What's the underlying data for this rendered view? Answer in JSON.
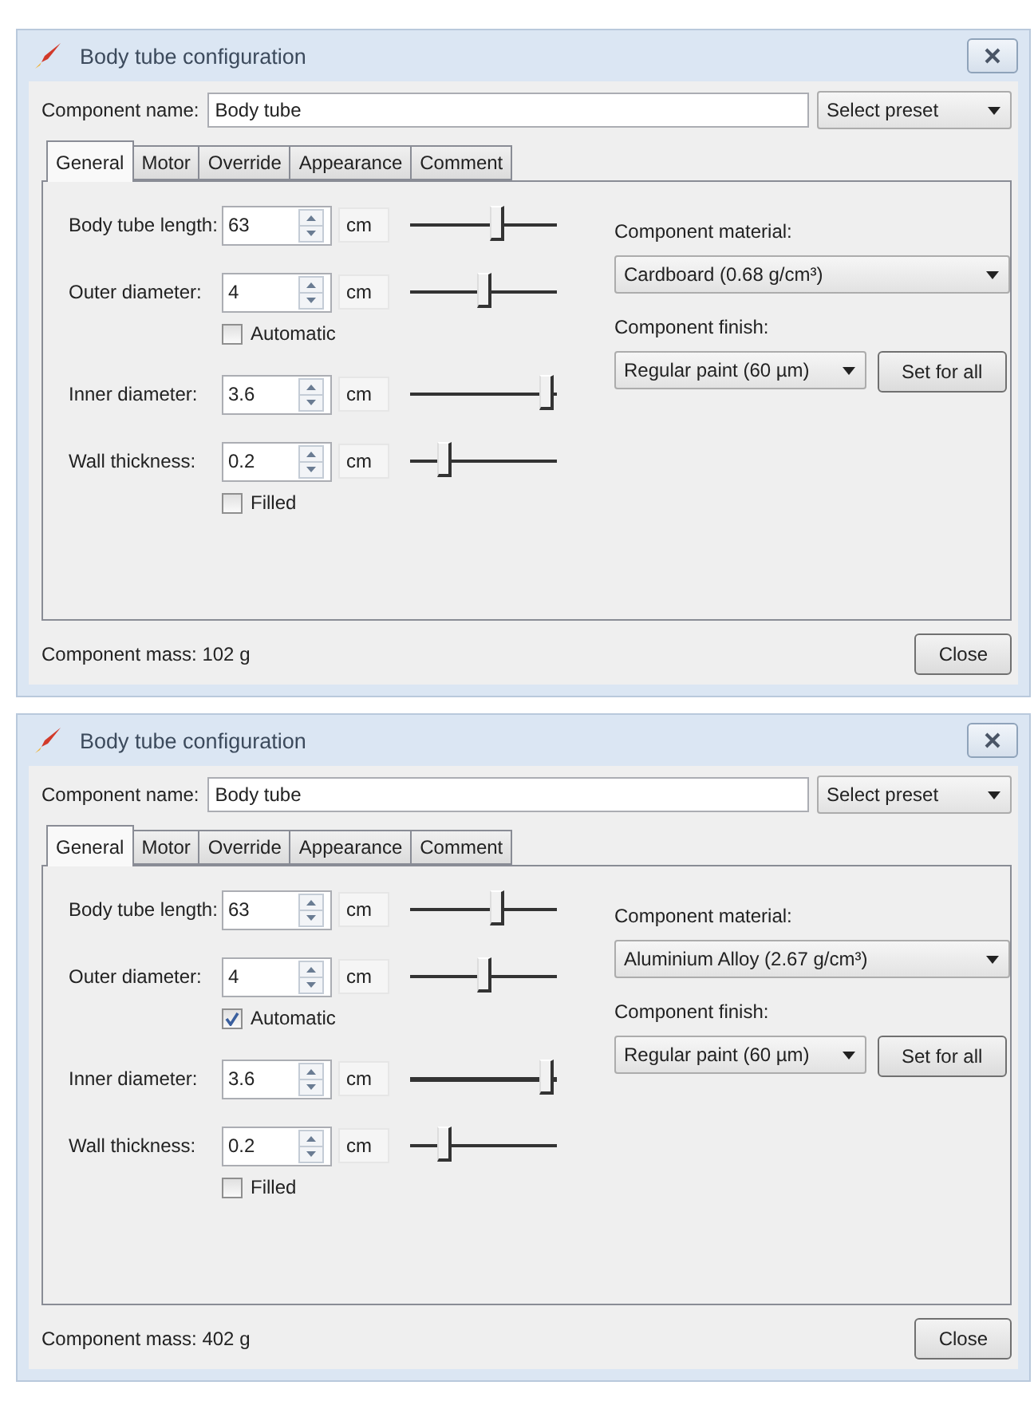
{
  "dialogs": [
    {
      "title": "Body tube configuration",
      "name_label": "Component name:",
      "name_value": "Body tube",
      "preset": "Select preset",
      "tabs": [
        {
          "label": "General",
          "selected": true
        },
        {
          "label": "Motor",
          "selected": false
        },
        {
          "label": "Override",
          "selected": false
        },
        {
          "label": "Appearance",
          "selected": false
        },
        {
          "label": "Comment",
          "selected": false
        }
      ],
      "fields": [
        {
          "label": "Body tube length:",
          "value": "63",
          "unit": "cm",
          "level": 0.6
        },
        {
          "label": "Outer diameter:",
          "value": "4",
          "unit": "cm",
          "level": 0.5,
          "option": {
            "label": "Automatic",
            "checked": false
          }
        },
        {
          "label": "Inner diameter:",
          "value": "3.6",
          "unit": "cm",
          "level": 0.98
        },
        {
          "label": "Wall thickness:",
          "value": "0.2",
          "unit": "cm",
          "level": 0.2,
          "option": {
            "label": "Filled",
            "checked": false
          }
        }
      ],
      "material_label": "Component material:",
      "material": "Cardboard (0.68 g/cm³)",
      "finish_label": "Component finish:",
      "finish": "Regular paint (60 µm)",
      "set_for_all": "Set for all",
      "mass": "Component mass: 102 g",
      "close": "Close"
    },
    {
      "title": "Body tube configuration",
      "name_label": "Component name:",
      "name_value": "Body tube",
      "preset": "Select preset",
      "tabs": [
        {
          "label": "General",
          "selected": true
        },
        {
          "label": "Motor",
          "selected": false
        },
        {
          "label": "Override",
          "selected": false
        },
        {
          "label": "Appearance",
          "selected": false
        },
        {
          "label": "Comment",
          "selected": false
        }
      ],
      "fields": [
        {
          "label": "Body tube length:",
          "value": "63",
          "unit": "cm",
          "level": 0.6
        },
        {
          "label": "Outer diameter:",
          "value": "4",
          "unit": "cm",
          "level": 0.5,
          "option": {
            "label": "Automatic",
            "checked": true
          }
        },
        {
          "label": "Inner diameter:",
          "value": "3.6",
          "unit": "cm",
          "level": 0.98
        },
        {
          "label": "Wall thickness:",
          "value": "0.2",
          "unit": "cm",
          "level": 0.2,
          "option": {
            "label": "Filled",
            "checked": false
          }
        }
      ],
      "material_label": "Component material:",
      "material": "Aluminium Alloy (2.67 g/cm³)",
      "finish_label": "Component finish:",
      "finish": "Regular paint (60 µm)",
      "set_for_all": "Set for all",
      "mass": "Component mass: 402 g",
      "close": "Close"
    }
  ]
}
